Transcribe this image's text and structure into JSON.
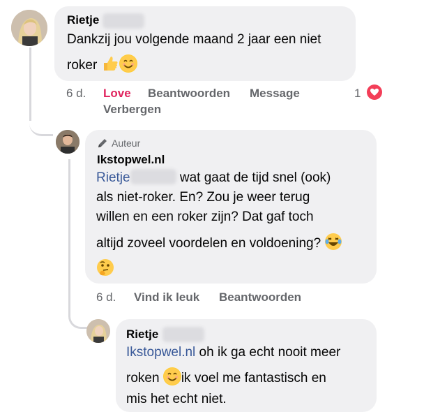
{
  "comment1": {
    "name": "Rietje",
    "line1": "Dankzij jou volgende maand 2 jaar een niet",
    "line2": "roker",
    "emojis": [
      "thumbs-up-emoji",
      "smiling-face-emoji"
    ],
    "actions": {
      "time": "6 d.",
      "love": "Love",
      "reply": "Beantwoorden",
      "message": "Message",
      "hide": "Verbergen"
    },
    "reaction_count": "1",
    "reaction_icon": "heart-icon"
  },
  "reply1": {
    "badge": "Auteur",
    "badge_icon": "pen-icon",
    "name": "Ikstopwel.nl",
    "mention": "Rietje",
    "line1": " wat gaat de tijd snel (ook)",
    "line2": "als niet-roker. En? Zou je weer terug",
    "line3": "willen en een roker zijn? Dat gaf toch",
    "line4": "altijd zoveel voordelen en voldoening?",
    "emojis": [
      "laughing-emoji",
      "thinking-face-emoji"
    ],
    "actions": {
      "time": "6 d.",
      "like": "Vind ik leuk",
      "reply": "Beantwoorden"
    }
  },
  "reply2": {
    "name": "Rietje",
    "mention": "Ikstopwel.nl",
    "line1": " oh ik ga echt nooit meer",
    "line2a": "roken",
    "line2b": "ik voel me fantastisch en",
    "line3": "mis het echt niet.",
    "emojis": [
      "smiling-face-emoji"
    ]
  },
  "colors": {
    "bubble": "#f0f0f2",
    "mention": "#385898",
    "love": "#e0245e",
    "meta": "#65676b"
  }
}
